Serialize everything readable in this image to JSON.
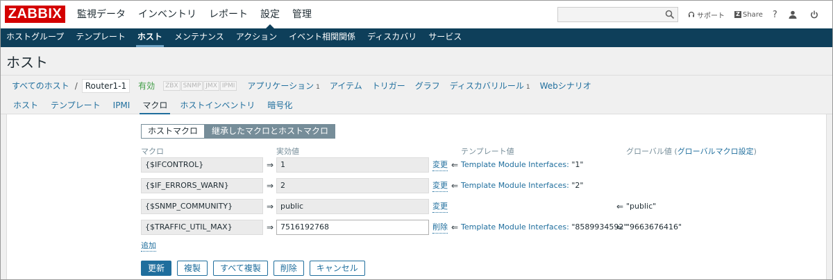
{
  "logo": "ZABBIX",
  "top_menu": [
    "監視データ",
    "インベントリ",
    "レポート",
    "設定",
    "管理"
  ],
  "top_links": {
    "support": "サポート",
    "share": "Share",
    "help": "?"
  },
  "sub_menu": [
    "ホストグループ",
    "テンプレート",
    "ホスト",
    "メンテナンス",
    "アクション",
    "イベント相関関係",
    "ディスカバリ",
    "サービス"
  ],
  "page_title": "ホスト",
  "hostnav": {
    "all_hosts": "すべてのホスト",
    "separator": "/",
    "current_host": "Router1-1",
    "status": "有効",
    "badges": [
      "ZBX",
      "SNMP",
      "JMX",
      "IPMI"
    ],
    "applications": "アプリケーション",
    "applications_count": "1",
    "items": "アイテム",
    "triggers": "トリガー",
    "graphs": "グラフ",
    "discovery": "ディスカバリルール",
    "discovery_count": "1",
    "web": "Webシナリオ"
  },
  "tabs": [
    "ホスト",
    "テンプレート",
    "IPMI",
    "マクロ",
    "ホストインベントリ",
    "暗号化"
  ],
  "toggle": {
    "host_macros": "ホストマクロ",
    "inherited": "継承したマクロとホストマクロ"
  },
  "columns": {
    "macro": "マクロ",
    "effective": "実効値",
    "template": "テンプレート値",
    "global_prefix": "グローバル値 (",
    "global_link": "グローバルマクロ設定",
    "global_suffix": ")"
  },
  "rows": [
    {
      "macro": "{$IFCONTROL}",
      "arrow": "⇒",
      "value": "1",
      "action": "変更",
      "tpl_arrow": "⇐",
      "tpl_name": "Template Module Interfaces:",
      "tpl_value": " \"1\"",
      "gl_arrow": "",
      "gl_value": ""
    },
    {
      "macro": "{$IF_ERRORS_WARN}",
      "arrow": "⇒",
      "value": "2",
      "action": "変更",
      "tpl_arrow": "⇐",
      "tpl_name": "Template Module Interfaces:",
      "tpl_value": " \"2\"",
      "gl_arrow": "",
      "gl_value": ""
    },
    {
      "macro": "{$SNMP_COMMUNITY}",
      "arrow": "⇒",
      "value": "public",
      "action": "変更",
      "tpl_arrow": "",
      "tpl_name": "",
      "tpl_value": "",
      "gl_arrow": "⇐",
      "gl_value": "\"public\""
    },
    {
      "macro": "{$TRAFFIC_UTIL_MAX}",
      "arrow": "⇒",
      "value": "7516192768",
      "action": "削除",
      "tpl_arrow": "⇐",
      "tpl_name": "Template Module Interfaces:",
      "tpl_value": " \"8589934592\"",
      "gl_arrow": "⇐",
      "gl_value": "\"9663676416\""
    }
  ],
  "add_link": "追加",
  "buttons": {
    "update": "更新",
    "clone": "複製",
    "full_clone": "すべて複製",
    "delete": "削除",
    "cancel": "キャンセル"
  }
}
